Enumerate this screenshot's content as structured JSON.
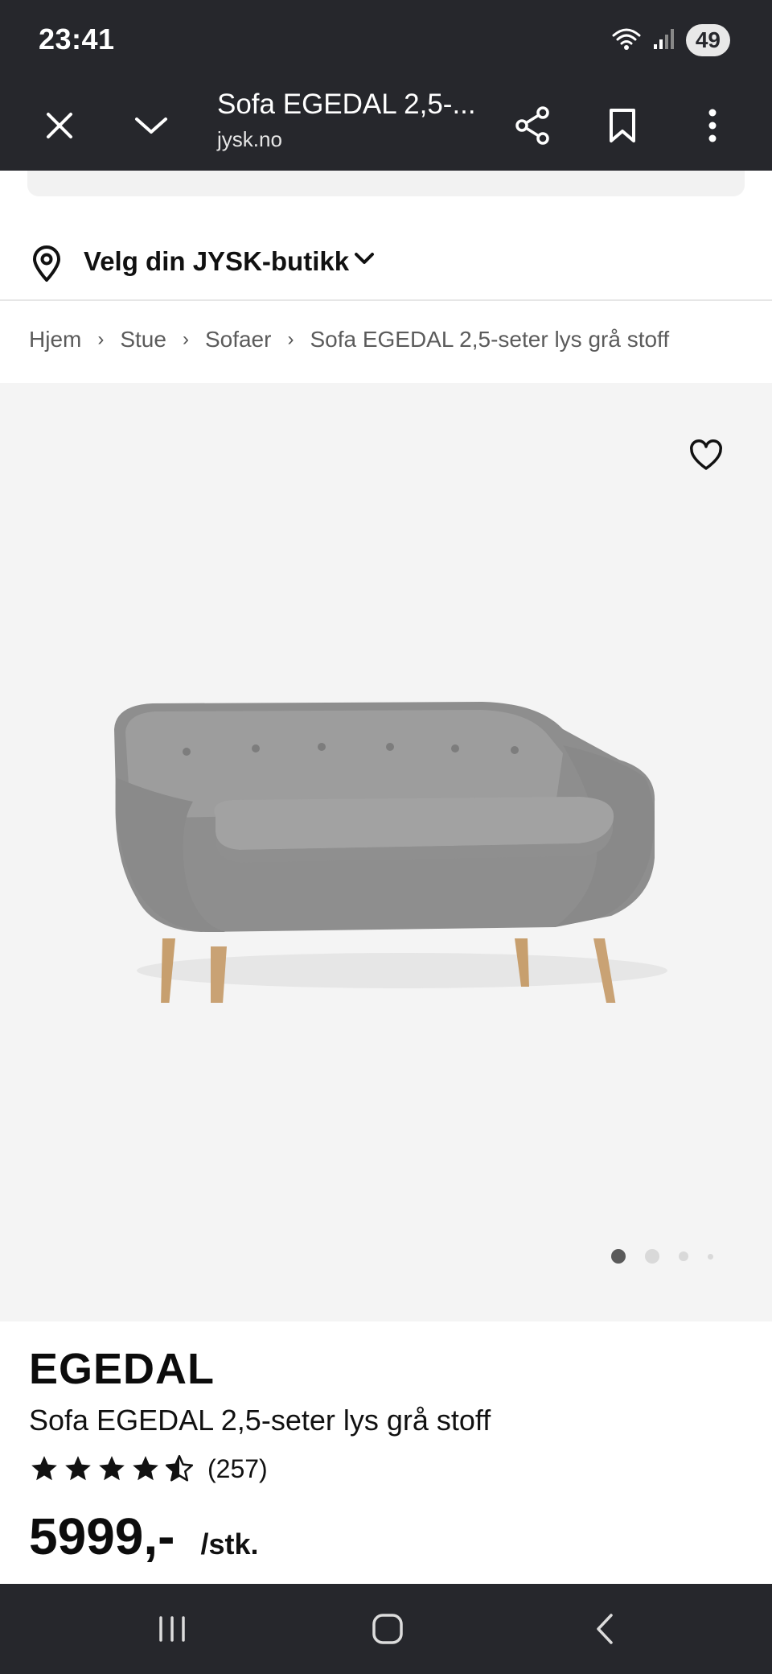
{
  "status_bar": {
    "time": "23:41",
    "battery": "49",
    "icons": [
      "wifi-icon",
      "signal-icon",
      "battery-icon"
    ]
  },
  "browser": {
    "title": "Sofa EGEDAL 2,5-...",
    "url": "jysk.no",
    "icons": [
      "close-icon",
      "chevron-down-icon",
      "share-icon",
      "bookmark-icon",
      "more-vert-icon"
    ]
  },
  "store": {
    "label": "Velg din JYSK-butikk"
  },
  "breadcrumb": {
    "items": [
      "Hjem",
      "Stue",
      "Sofaer",
      "Sofa EGEDAL 2,5-seter lys grå stoff"
    ]
  },
  "gallery": {
    "image_count": 4,
    "active_index": 0
  },
  "product": {
    "brand": "EGEDAL",
    "name": "Sofa EGEDAL 2,5-seter lys grå stoff",
    "rating": 4.5,
    "rating_count": "(257)",
    "price": "5999,-",
    "unit": "/stk."
  },
  "colors": {
    "chrome": "#26272c",
    "gallery_bg": "#f4f4f4",
    "text": "#111111",
    "breadcrumb": "#5b5b5b"
  }
}
